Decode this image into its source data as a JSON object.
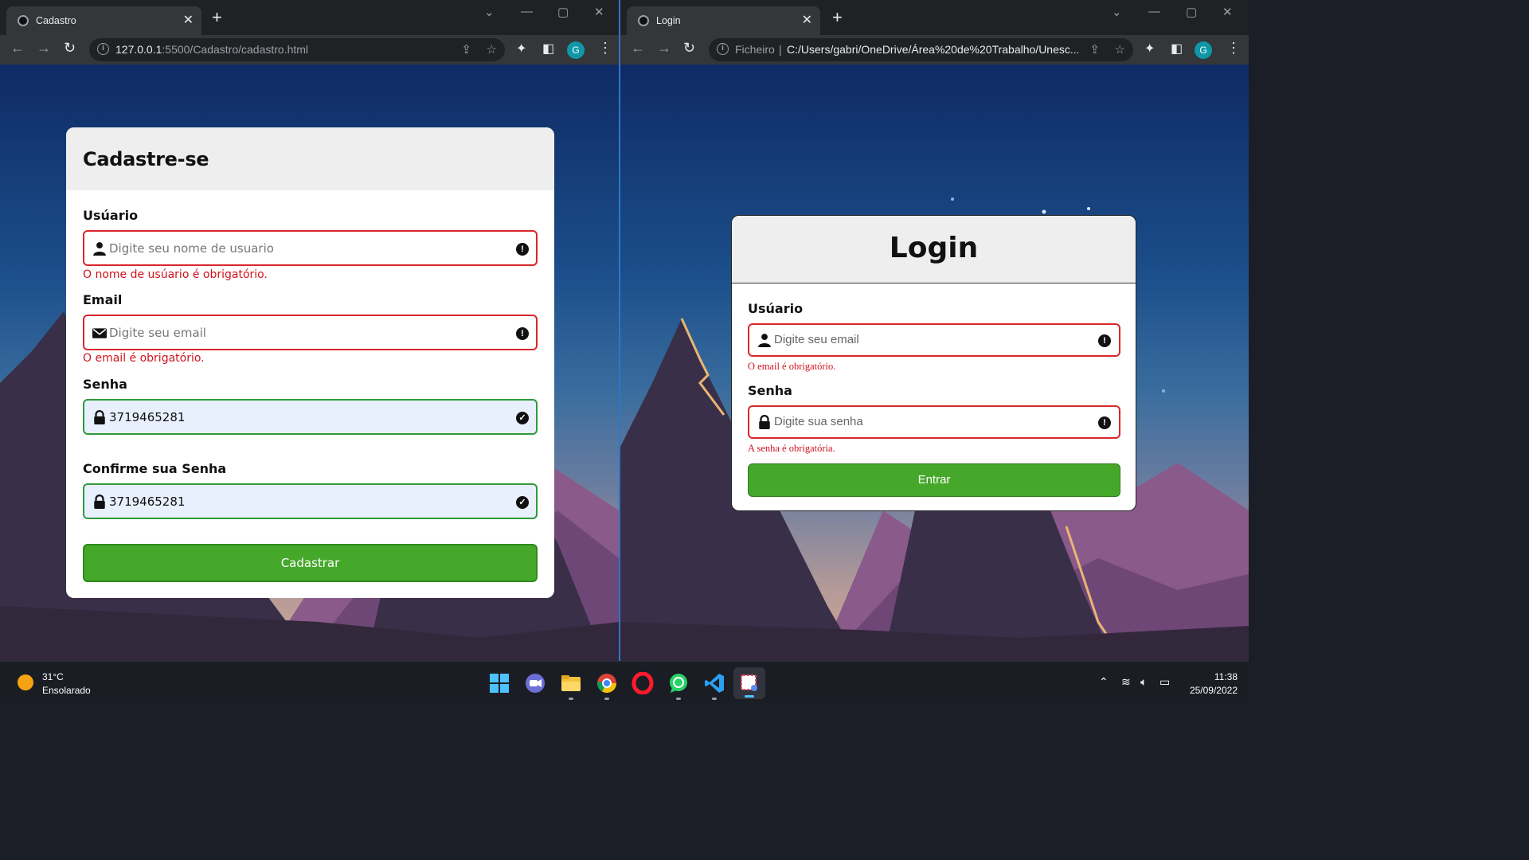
{
  "left_window": {
    "tab_title": "Cadastro",
    "url_main": "127.0.0.1",
    "url_rest": ":5500/Cadastro/cadastro.html",
    "avatar_letter": "G",
    "form": {
      "title": "Cadastre-se",
      "username_label": "Usúario",
      "username_placeholder": "Digite seu nome de usuario",
      "username_error": "O nome de usúario é obrigatório.",
      "email_label": "Email",
      "email_placeholder": "Digite seu email",
      "email_error": "O email é obrigatório.",
      "password_label": "Senha",
      "password_value": "3719465281",
      "confirm_label": "Confirme sua Senha",
      "confirm_value": "3719465281",
      "submit_label": "Cadastrar"
    }
  },
  "right_window": {
    "tab_title": "Login",
    "url_prefix": "Ficheiro",
    "url_path": "C:/Users/gabri/OneDrive/Área%20de%20Trabalho/Unesc...",
    "avatar_letter": "G",
    "form": {
      "title": "Login",
      "username_label": "Usúario",
      "username_placeholder": "Digite seu email",
      "username_error": "O email é obrigatório.",
      "password_label": "Senha",
      "password_placeholder": "Digite sua senha",
      "password_error": "A senha é obrigatória.",
      "submit_label": "Entrar"
    }
  },
  "taskbar": {
    "temperature": "31°C",
    "condition": "Ensolarado",
    "time": "11:38",
    "date": "25/09/2022",
    "apps": [
      "start-icon",
      "teams-icon",
      "file-explorer-icon",
      "chrome-icon",
      "opera-icon",
      "whatsapp-icon",
      "vscode-icon",
      "snipping-tool-icon"
    ]
  },
  "colors": {
    "error_border": "#d9262c",
    "valid_border": "#2f9a3a",
    "button_green": "#46a82b",
    "error_text": "#d0131d"
  }
}
